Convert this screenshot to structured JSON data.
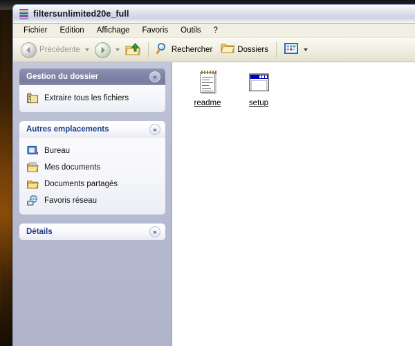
{
  "window": {
    "title": "filtersunlimited20e_full",
    "app_icon": "winrar-archive-icon"
  },
  "menubar": {
    "items": [
      {
        "label": "Fichier"
      },
      {
        "label": "Edition"
      },
      {
        "label": "Affichage"
      },
      {
        "label": "Favoris"
      },
      {
        "label": "Outils"
      },
      {
        "label": "?"
      }
    ]
  },
  "toolbar": {
    "back_label": "Précédente",
    "back_icon": "arrow-left-icon",
    "forward_icon": "arrow-right-icon",
    "up_icon": "up-folder-icon",
    "search_label": "Rechercher",
    "search_icon": "magnifier-icon",
    "folders_label": "Dossiers",
    "folders_icon": "folder-icon",
    "views_icon": "views-grid-icon"
  },
  "sidebar": {
    "panels": [
      {
        "title": "Gestion du dossier",
        "style": "dark",
        "toggle_icon": "chevron-up-double-icon",
        "toggle_glyph": "«",
        "rows": [
          {
            "label": "Extraire tous les fichiers",
            "icon": "extract-folder-icon"
          }
        ]
      },
      {
        "title": "Autres emplacements",
        "style": "light",
        "toggle_icon": "chevron-up-double-icon",
        "toggle_glyph": "«",
        "rows": [
          {
            "label": "Bureau",
            "icon": "desktop-icon"
          },
          {
            "label": "Mes documents",
            "icon": "my-documents-icon"
          },
          {
            "label": "Documents partagés",
            "icon": "shared-documents-folder-icon"
          },
          {
            "label": "Favoris réseau",
            "icon": "network-neighborhood-icon"
          }
        ]
      },
      {
        "title": "Détails",
        "style": "light",
        "toggle_icon": "chevron-down-double-icon",
        "toggle_glyph": "»",
        "rows": []
      }
    ]
  },
  "content": {
    "files": [
      {
        "name": "readme",
        "icon": "notepad-text-file-icon"
      },
      {
        "name": "setup",
        "icon": "executable-window-icon"
      }
    ]
  },
  "colors": {
    "titlebar": "#e3e5ee",
    "sidebar": "#b8bcd2",
    "panel_head_dark": "#7e84a6",
    "content_bg": "#ffffff",
    "link_text": "#14309c",
    "desktop": "#3a2208"
  }
}
